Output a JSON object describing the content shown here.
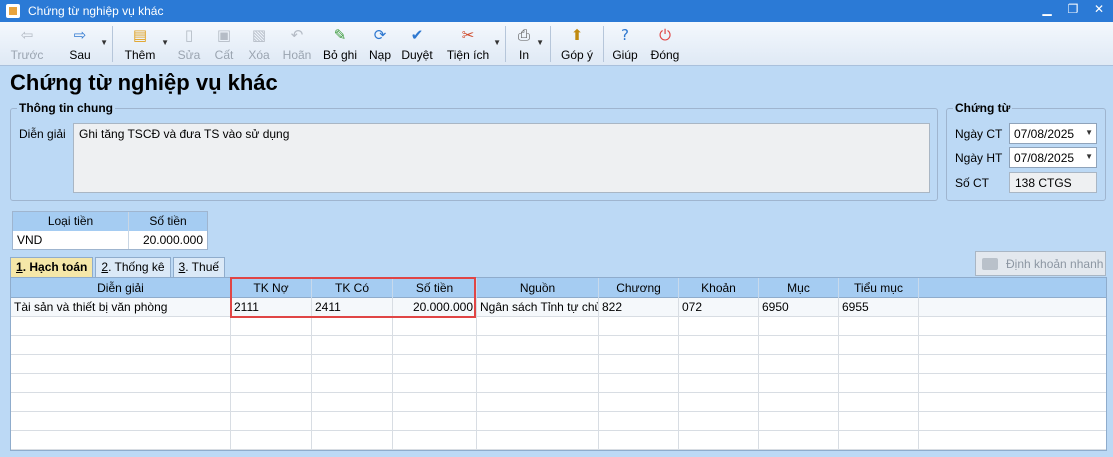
{
  "window": {
    "title": "Chứng từ nghiệp vụ khác"
  },
  "toolbar": {
    "prev": "Trước",
    "next": "Sau",
    "add": "Thêm",
    "edit": "Sửa",
    "save": "Cất",
    "delete": "Xóa",
    "undo": "Hoãn",
    "unpost": "Bỏ ghi",
    "reload": "Nạp",
    "approve": "Duyệt",
    "utilities": "Tiện ích",
    "print": "In",
    "feedback": "Góp ý",
    "help": "Giúp",
    "close": "Đóng"
  },
  "page_title": "Chứng từ nghiệp vụ khác",
  "general_info": {
    "legend": "Thông tin chung",
    "description_label": "Diễn giải",
    "description_value": "Ghi tăng TSCĐ và đưa TS vào sử dụng"
  },
  "voucher": {
    "legend": "Chứng từ",
    "voucher_date_label": "Ngày CT",
    "voucher_date": "07/08/2025",
    "posting_date_label": "Ngày HT",
    "posting_date": "07/08/2025",
    "number_label": "Số CT",
    "number": "138 CTGS"
  },
  "currency_table": {
    "headers": [
      "Loại tiền",
      "Số tiền"
    ],
    "row": [
      "VND",
      "20.000.000"
    ]
  },
  "tabs": [
    {
      "key": "1",
      "label": ". Hạch toán"
    },
    {
      "key": "2",
      "label": ". Thống kê"
    },
    {
      "key": "3",
      "label": ". Thuế"
    }
  ],
  "quick_entry_button": "Định khoản nhanh",
  "grid": {
    "headers": [
      "Diễn giải",
      "TK Nợ",
      "TK Có",
      "Số tiền",
      "Nguồn",
      "Chương",
      "Khoản",
      "Mục",
      "Tiểu mục"
    ],
    "rows": [
      [
        "Tài sản và thiết bị văn phòng",
        "2111",
        "2411",
        "20.000.000",
        "Ngân sách Tỉnh tự chủ",
        "822",
        "072",
        "6950",
        "6955"
      ]
    ]
  },
  "icons": {
    "prev": "arrow-left-icon",
    "next": "arrow-right-icon",
    "add": "new-document-icon",
    "edit": "edit-icon",
    "save": "save-icon",
    "delete": "delete-icon",
    "undo": "undo-icon",
    "unpost": "unpost-icon",
    "reload": "refresh-icon",
    "approve": "approve-icon",
    "utilities": "tools-icon",
    "print": "printer-icon",
    "feedback": "feedback-icon",
    "help": "help-icon",
    "close": "power-icon"
  },
  "colors": {
    "accent": "#2b7ad6",
    "highlight_border": "#e04545",
    "active_tab": "#f5e7a8"
  }
}
